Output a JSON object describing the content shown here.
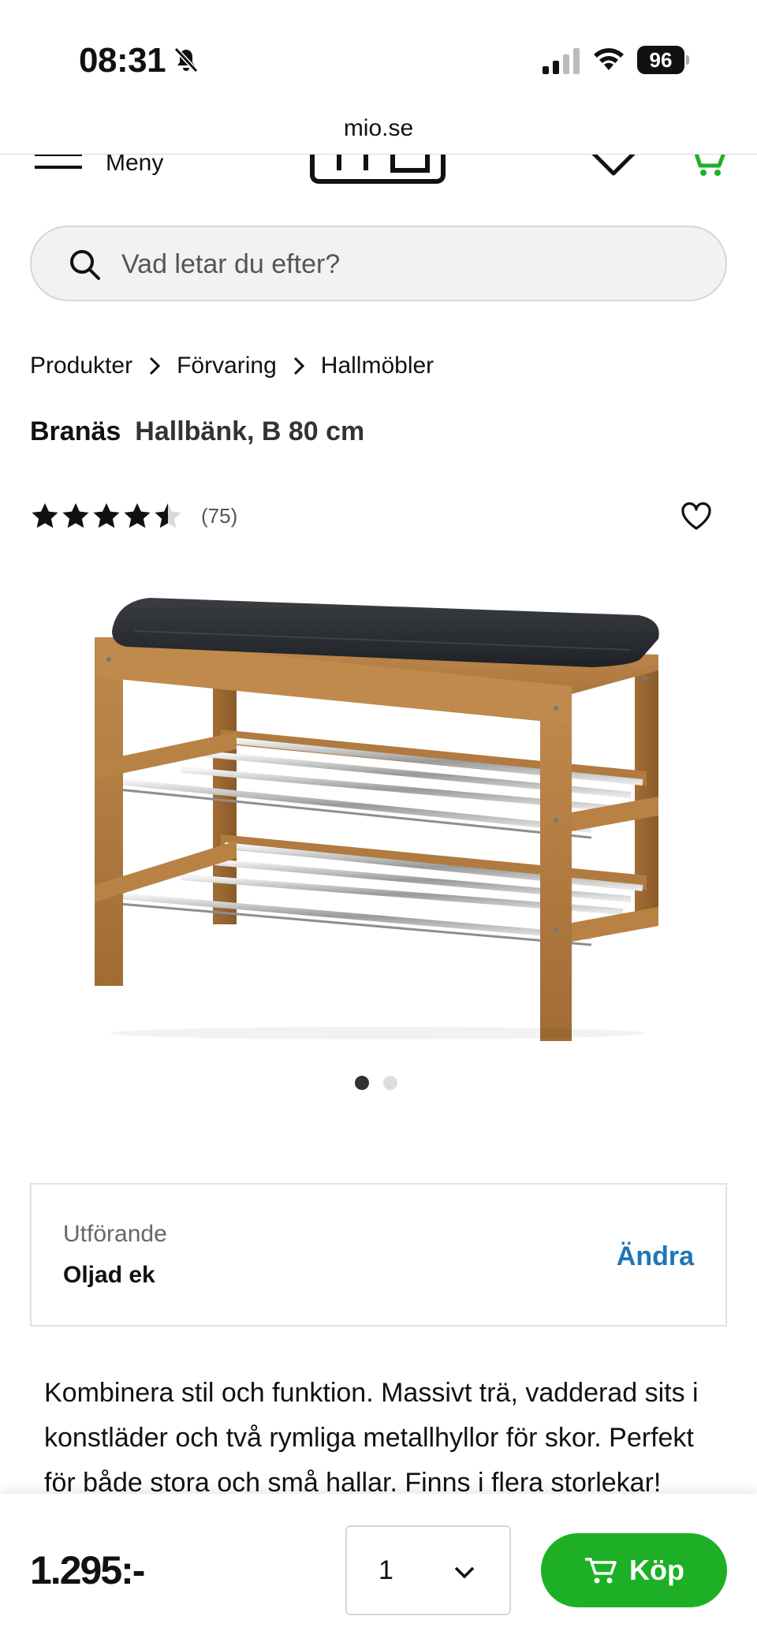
{
  "status_bar": {
    "time": "08:31",
    "battery": "96"
  },
  "browser": {
    "url": "mio.se"
  },
  "header": {
    "menu_label": "Meny",
    "accent_color": "#1db026"
  },
  "search": {
    "placeholder": "Vad letar du efter?"
  },
  "breadcrumb": [
    "Produkter",
    "Förvaring",
    "Hallmöbler"
  ],
  "product": {
    "brand": "Branäs",
    "name": "Hallbänk, B 80 cm",
    "rating": 4.5,
    "rating_max": 5,
    "review_count": "(75)",
    "image_count": 2,
    "active_image": 1
  },
  "variant": {
    "label": "Utförande",
    "value": "Oljad ek",
    "change_label": "Ändra",
    "link_color": "#1f76b8"
  },
  "description": "Kombinera stil och funktion. Massivt trä, vadderad sits i konstläder och två rymliga metallhyllor för skor. Perfekt för både stora och små hallar. Finns i flera storlekar!",
  "buy_bar": {
    "price": "1.295:-",
    "quantity": "1",
    "buy_label": "Köp",
    "button_color": "#1db026"
  }
}
